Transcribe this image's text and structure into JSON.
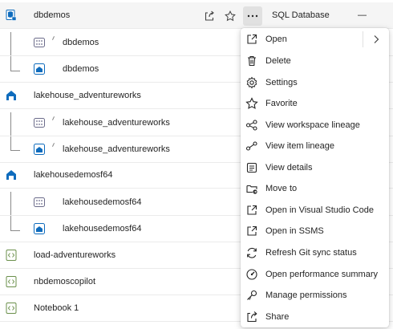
{
  "items": [
    {
      "name": "dbdemos",
      "icon": "sql-database-icon",
      "level": 0,
      "type": "SQL Database",
      "dash": "—"
    },
    {
      "name": "dbdemos",
      "icon": "sql-endpoint-icon",
      "level": 1
    },
    {
      "name": "dbdemos",
      "icon": "semantic-model-icon",
      "level": 1
    },
    {
      "name": "lakehouse_adventureworks",
      "icon": "lakehouse-icon",
      "level": 0
    },
    {
      "name": "lakehouse_adventureworks",
      "icon": "sql-endpoint-icon",
      "level": 1
    },
    {
      "name": "lakehouse_adventureworks",
      "icon": "semantic-model-icon",
      "level": 1
    },
    {
      "name": "lakehousedemosf64",
      "icon": "lakehouse-icon",
      "level": 0
    },
    {
      "name": "lakehousedemosf64",
      "icon": "sql-endpoint-icon",
      "level": 1
    },
    {
      "name": "lakehousedemosf64",
      "icon": "semantic-model-icon",
      "level": 1
    },
    {
      "name": "load-adventureworks",
      "icon": "notebook-icon",
      "level": 0
    },
    {
      "name": "nbdemoscopilot",
      "icon": "notebook-icon",
      "level": 0
    },
    {
      "name": "Notebook 1",
      "icon": "notebook-icon",
      "level": 0
    }
  ],
  "menu": [
    {
      "label": "Open",
      "icon": "open-icon",
      "submenu": true
    },
    {
      "label": "Delete",
      "icon": "trash-icon"
    },
    {
      "label": "Settings",
      "icon": "gear-icon"
    },
    {
      "label": "Favorite",
      "icon": "star-icon"
    },
    {
      "label": "View workspace lineage",
      "icon": "lineage-icon"
    },
    {
      "label": "View item lineage",
      "icon": "item-lineage-icon"
    },
    {
      "label": "View details",
      "icon": "details-icon"
    },
    {
      "label": "Move to",
      "icon": "move-icon"
    },
    {
      "label": "Open in Visual Studio Code",
      "icon": "open-external-icon"
    },
    {
      "label": "Open in SSMS",
      "icon": "open-external-icon"
    },
    {
      "label": "Refresh Git sync status",
      "icon": "refresh-icon"
    },
    {
      "label": "Open performance summary",
      "icon": "performance-icon"
    },
    {
      "label": "Manage permissions",
      "icon": "key-icon"
    },
    {
      "label": "Share",
      "icon": "share-icon"
    }
  ],
  "colors": {
    "accent": "#0f6cbd",
    "selected_row": "#f5f5f5",
    "more_active": "#e1e1e1"
  }
}
